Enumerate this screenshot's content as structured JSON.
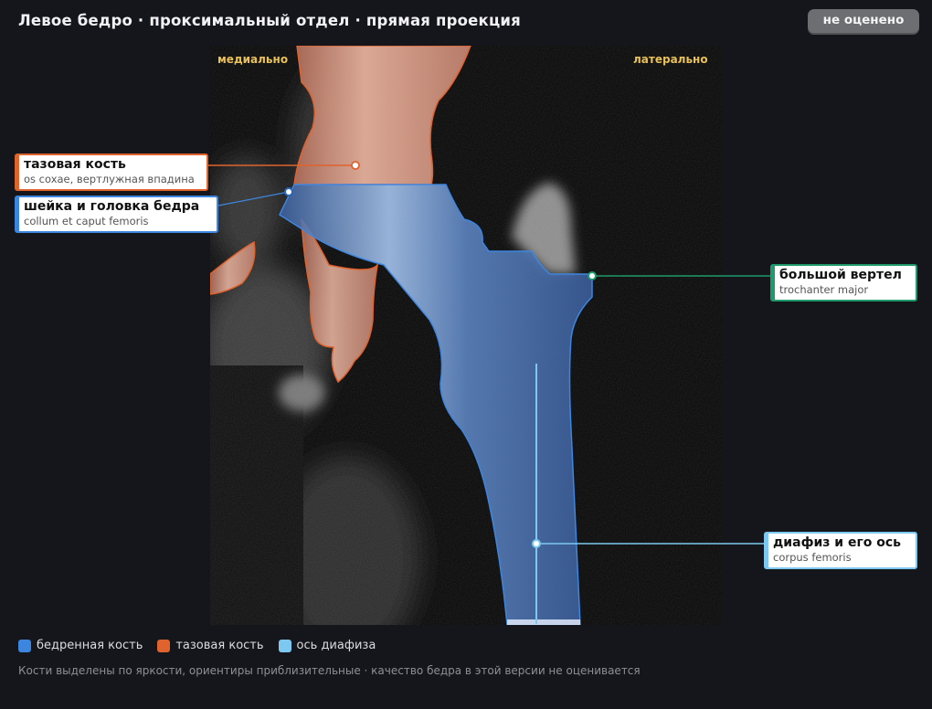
{
  "header": {
    "title": "Левое бедро · проксимальный отдел · прямая проекция",
    "status_badge": "не оценено"
  },
  "image": {
    "orientation_left": "медиально",
    "orientation_right": "латерально"
  },
  "callouts": {
    "pelvis": {
      "label": "тазовая кость",
      "sublabel": "os coxae, вертлужная впадина",
      "color": "#e0622d"
    },
    "femoral_neck": {
      "label": "шейка и головка бедра",
      "sublabel": "collum et caput femoris",
      "color": "#3d86e0"
    },
    "greater_trochanter": {
      "label": "большой вертел",
      "sublabel": "trochanter major",
      "color": "#1f9a6b"
    },
    "shaft": {
      "label": "диафиз и его ось",
      "sublabel": "corpus femoris",
      "color": "#7cc8f0"
    }
  },
  "legend": [
    {
      "label": "бедренная кость",
      "color": "#3d86e0"
    },
    {
      "label": "тазовая кость",
      "color": "#e0622d"
    },
    {
      "label": "ось диафиза",
      "color": "#7cc8f0"
    }
  ],
  "footnote": "Кости выделены по яркости, ориентиры приблизительные · качество бедра в этой версии не оценивается"
}
